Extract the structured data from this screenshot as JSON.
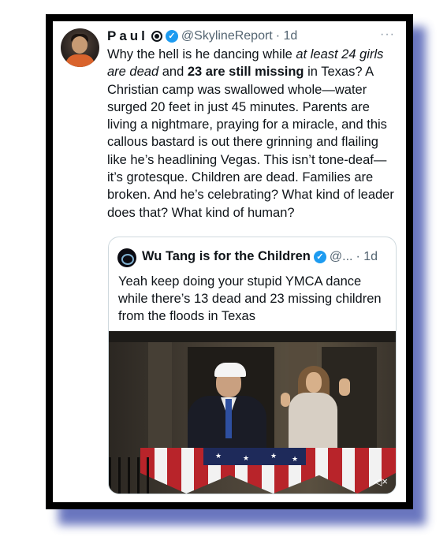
{
  "tweet": {
    "author_name": "Paul",
    "handle": "@SkylineReport",
    "time": "· 1d",
    "more": "···",
    "body_parts": [
      {
        "text": "Why the hell is he dancing while ",
        "style": "normal"
      },
      {
        "text": "at least 24 girls are dead",
        "style": "italic"
      },
      {
        "text": " and ",
        "style": "normal"
      },
      {
        "text": "23 are still missing",
        "style": "bold"
      },
      {
        "text": " in Texas? A Christian camp was swallowed whole—water surged 20 feet in just 45 minutes. Parents are living a nightmare, praying for a miracle, and this callous bastard is out there grinning and flailing like he’s headlining Vegas. This isn’t tone-deaf—it’s grotesque. Children are dead. Families are broken. And he’s celebrating? What kind of leader does that? What kind of human?",
        "style": "normal"
      }
    ]
  },
  "quote": {
    "author_name": "Wu Tang is for the Children",
    "handle": "@...",
    "time": "· 1d",
    "text": "Yeah keep doing your stupid YMCA dance while there’s 13 dead and 23 missing children from the floods in Texas",
    "mute_icon": "speaker-muted-icon",
    "mute_glyph": "◁×"
  },
  "colors": {
    "verified": "#1d9bf0",
    "frame": "#000000",
    "shadow": "#5a68b8",
    "muted_text": "#536471"
  }
}
